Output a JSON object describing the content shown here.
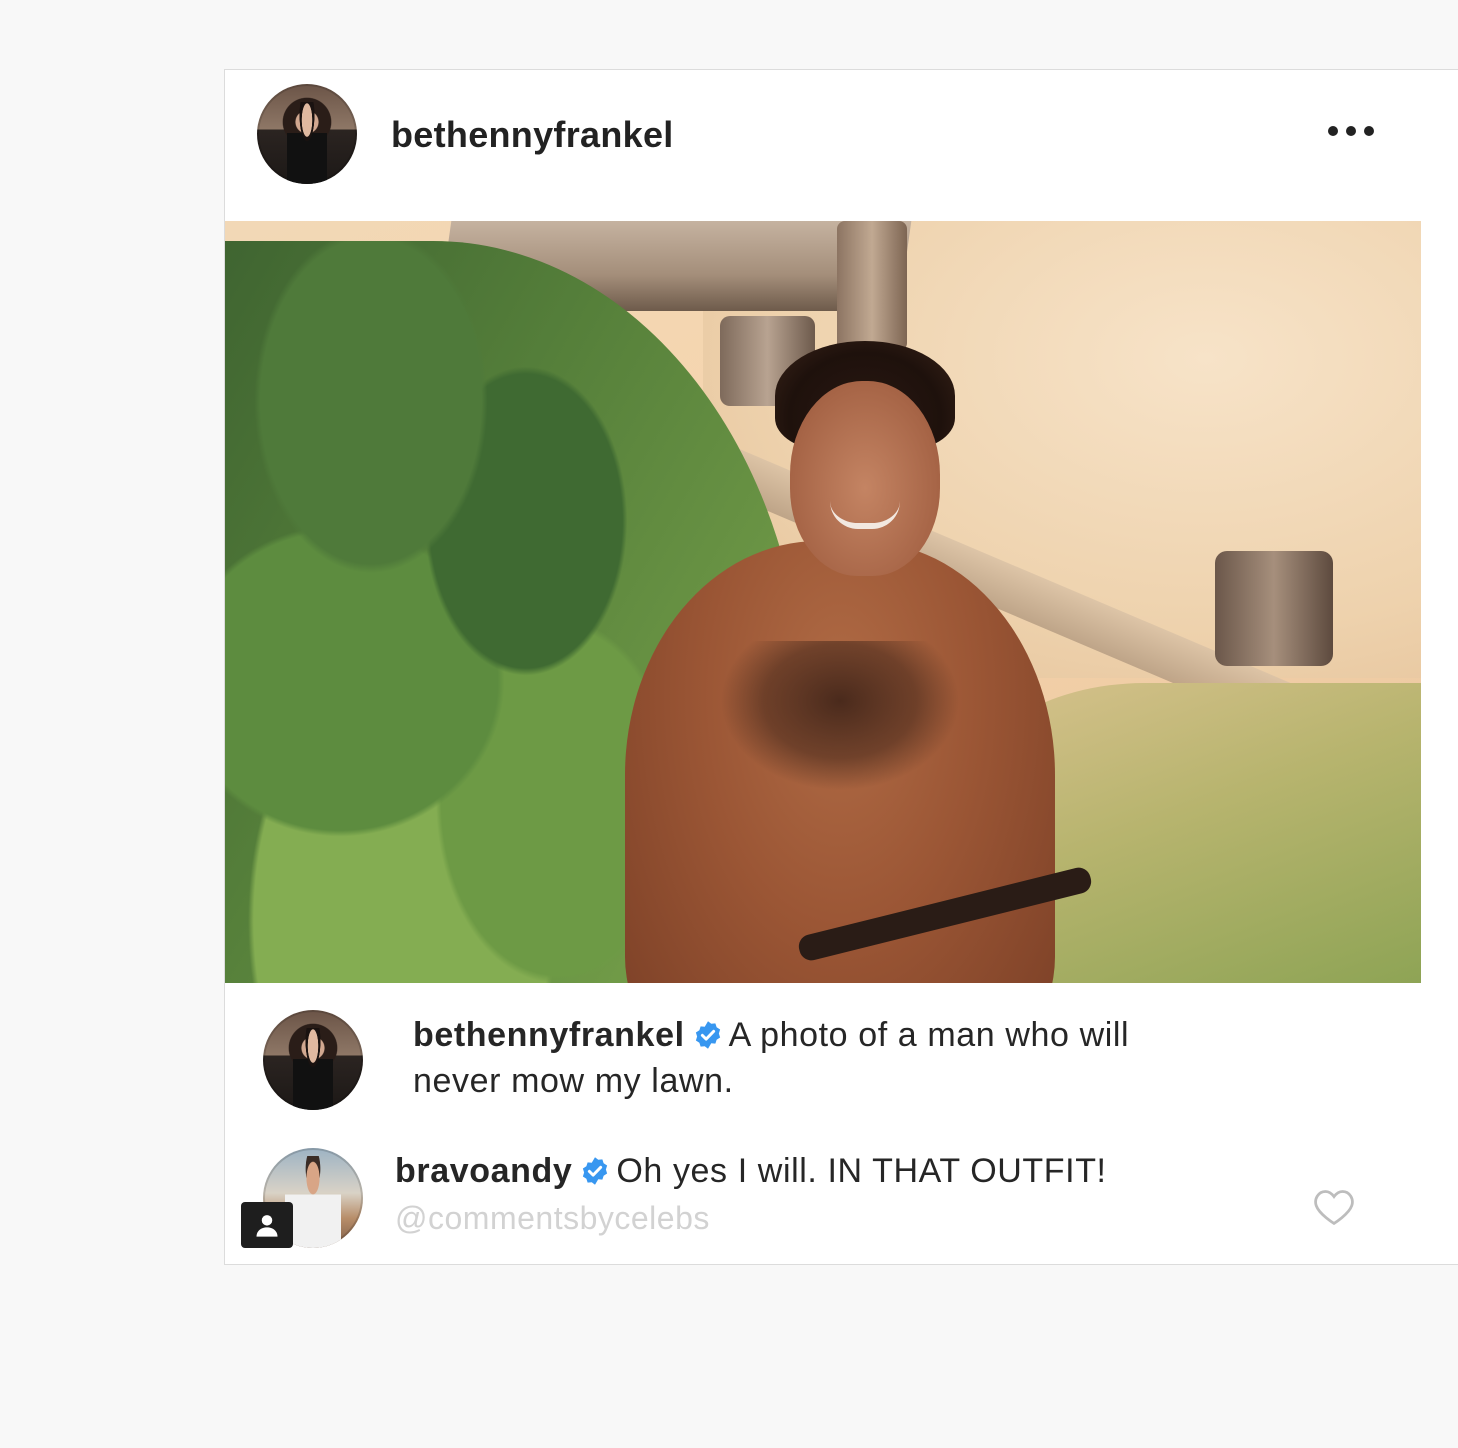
{
  "post": {
    "author": "bethennyfrankel",
    "more_icon": "more-horizontal-icon",
    "photo_alt": "photo"
  },
  "comments": [
    {
      "username": "bethennyfrankel",
      "verified": true,
      "text": "A photo of a man who will",
      "text_line2": "never mow my lawn."
    },
    {
      "username": "bravoandy",
      "verified": true,
      "text": "Oh yes I will. IN THAT OUTFIT!"
    }
  ],
  "watermark": "@commentsbycelebs",
  "icons": {
    "verified": "verified-badge-icon",
    "like": "heart-icon",
    "profile": "person-icon"
  },
  "colors": {
    "verified_blue": "#3897f0",
    "text": "#262626",
    "watermark": "#d2d2d2"
  }
}
